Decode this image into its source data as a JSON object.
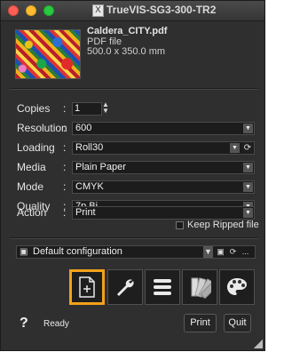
{
  "window": {
    "title": "TrueVIS-SG3-300-TR2",
    "app_icon": "X"
  },
  "file": {
    "name": "Caldera_CITY.pdf",
    "type": "PDF file",
    "size": "500.0 x 350.0 mm"
  },
  "settings": {
    "copies": {
      "label": "Copies",
      "value": "1"
    },
    "resolution": {
      "label": "Resolution",
      "value": "600"
    },
    "loading": {
      "label": "Loading",
      "value": "Roll30"
    },
    "media": {
      "label": "Media",
      "value": "Plain Paper"
    },
    "mode": {
      "label": "Mode",
      "value": "CMYK"
    },
    "quality": {
      "label": "Quality",
      "value": "7p Bi"
    },
    "action": {
      "label": "Action",
      "value": "Print"
    },
    "colon": ":"
  },
  "keep_ripped": {
    "label": "Keep Ripped file",
    "checked": false
  },
  "configuration": {
    "value": "Default configuration",
    "more": "..."
  },
  "toolbar": {
    "icons": [
      "new-job-icon",
      "wrench-icon",
      "list-icon",
      "color-swatches-icon",
      "palette-icon"
    ],
    "active_color": "#f3a21a"
  },
  "footer": {
    "help": "?",
    "status": "Ready",
    "print": "Print",
    "quit": "Quit"
  }
}
